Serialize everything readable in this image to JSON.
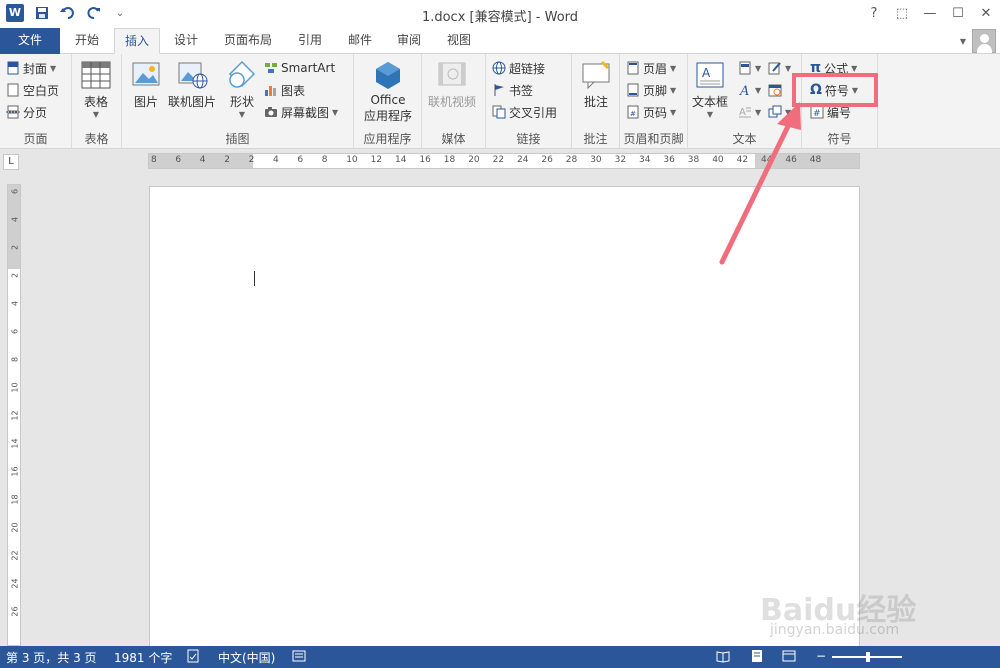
{
  "window": {
    "title": "1.docx [兼容模式] - Word",
    "help": "?",
    "restore_ribbon": "⬚",
    "minimize": "—",
    "maximize": "☐",
    "close": "✕"
  },
  "qat": {
    "app_icon_letter": "W",
    "customize": "⌄"
  },
  "tabs": [
    {
      "label": "文件"
    },
    {
      "label": "开始"
    },
    {
      "label": "插入"
    },
    {
      "label": "设计"
    },
    {
      "label": "页面布局"
    },
    {
      "label": "引用"
    },
    {
      "label": "邮件"
    },
    {
      "label": "审阅"
    },
    {
      "label": "视图"
    }
  ],
  "ribbon": {
    "pages": {
      "label": "页面",
      "cover": "封面",
      "blank": "空白页",
      "break": "分页"
    },
    "tables": {
      "label": "表格",
      "table": "表格"
    },
    "illustrations": {
      "label": "插图",
      "picture": "图片",
      "online_picture": "联机图片",
      "shapes": "形状",
      "smartart": "SmartArt",
      "chart": "图表",
      "screenshot": "屏幕截图"
    },
    "apps": {
      "label": "应用程序",
      "office_line1": "Office",
      "office_line2": "应用程序"
    },
    "media": {
      "label": "媒体",
      "video": "联机视频"
    },
    "links": {
      "label": "链接",
      "hyperlink": "超链接",
      "bookmark": "书签",
      "crossref": "交叉引用"
    },
    "comments": {
      "label": "批注",
      "comment": "批注"
    },
    "header_footer": {
      "label": "页眉和页脚",
      "header": "页眉",
      "footer": "页脚",
      "page_number": "页码"
    },
    "text": {
      "label": "文本",
      "textbox": "文本框"
    },
    "symbols": {
      "label": "符号",
      "equation": "公式",
      "symbol": "符号",
      "numbering": "编号"
    }
  },
  "ruler": {
    "h_ticks": [
      "8",
      "6",
      "4",
      "2",
      "2",
      "4",
      "6",
      "8",
      "10",
      "12",
      "14",
      "16",
      "18",
      "20",
      "22",
      "24",
      "26",
      "28",
      "30",
      "32",
      "34",
      "36",
      "38",
      "40",
      "42",
      "44",
      "46",
      "48"
    ],
    "v_ticks": [
      "6",
      "4",
      "2",
      "2",
      "4",
      "6",
      "8",
      "10",
      "12",
      "14",
      "16",
      "18",
      "20",
      "22",
      "24",
      "26"
    ],
    "corner": "L"
  },
  "status": {
    "page": "第 3 页，共 3 页",
    "words": "1981 个字",
    "language": "中文(中国)"
  },
  "colors": {
    "accent": "#2b579a",
    "highlight": "#ef6d7d"
  },
  "watermark": {
    "brand": "Baidu经验",
    "url": "jingyan.baidu.com"
  }
}
